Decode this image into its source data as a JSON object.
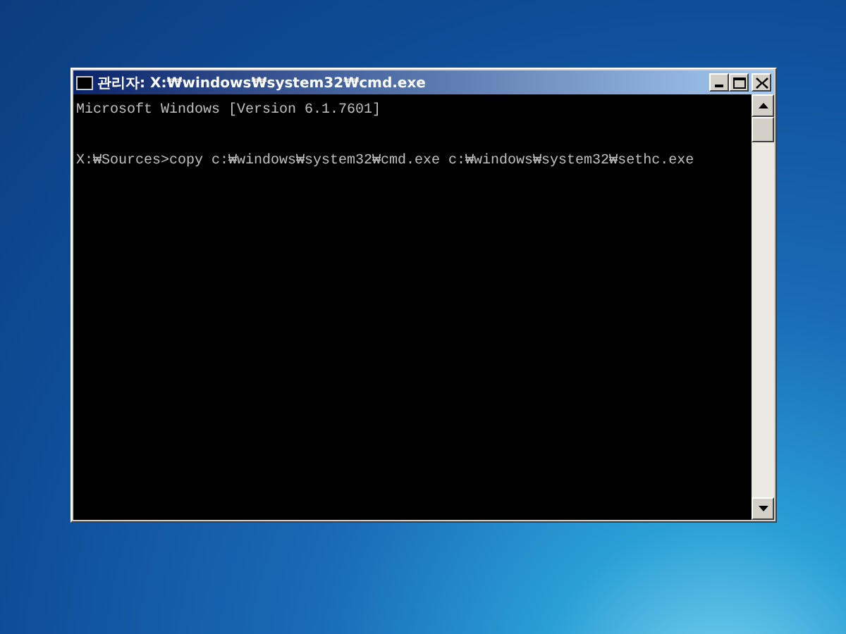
{
  "window": {
    "title": "관리자: X:₩windows₩system32₩cmd.exe"
  },
  "console": {
    "lines": [
      {
        "text": "Microsoft Windows [Version 6.1.7601]"
      },
      {
        "text": "X:₩Sources>copy c:₩windows₩system32₩cmd.exe c:₩windows₩system32₩sethc.exe"
      }
    ]
  }
}
